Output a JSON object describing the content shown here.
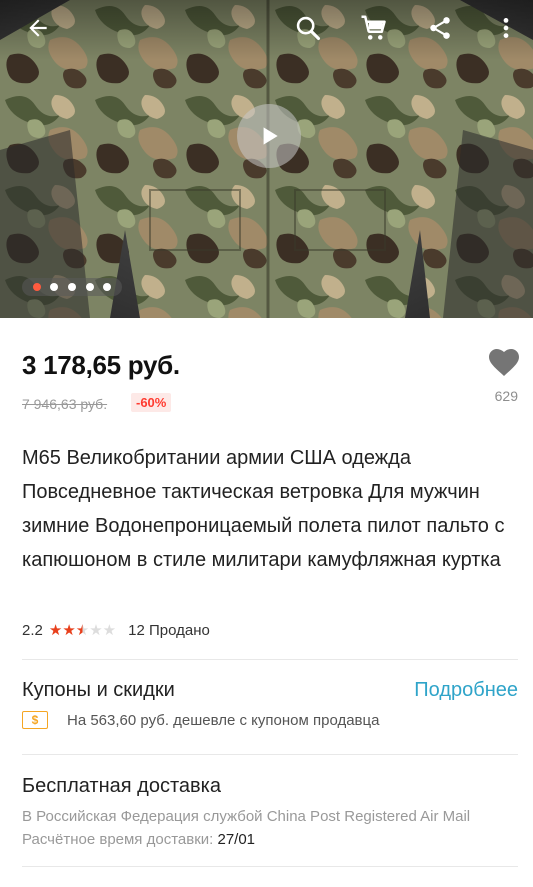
{
  "hero": {
    "image_alt": "camouflage jacket",
    "pager_count": 5,
    "pager_active": 0
  },
  "product": {
    "price": "3 178,65 руб.",
    "old_price": "7 946,63 руб.",
    "discount": "-60%",
    "favorites_count": "629",
    "title": "M65 Великобритании армии США одежда Повседневное тактическая ветровка Для мужчин зимние Водонепроницаемый полета пилот пальто с капюшоном в стиле милитари камуфляжная куртка",
    "rating": "2.2",
    "rating_stars": 2.5,
    "sold": "12 Продано"
  },
  "coupons": {
    "heading": "Купоны и скидки",
    "more_link": "Подробнее",
    "coupon_icon_text": "$",
    "coupon_text": "На 563,60 руб. дешевле с купоном продавца"
  },
  "shipping": {
    "heading": "Бесплатная доставка",
    "line1": "В Российская Федерация службой China Post Registered Air Mail",
    "line2_label": "Расчётное время доставки: ",
    "line2_date": "27/01"
  },
  "colors": {
    "price": "#111111",
    "discount": "#ff3b30",
    "link": "#2fa4c9",
    "star": "#e8401c",
    "pager_active": "#ff5b3f"
  },
  "icons": {
    "back": "back-arrow-icon",
    "search": "search-icon",
    "cart": "cart-icon",
    "share": "share-icon",
    "more": "more-vertical-icon",
    "play": "play-icon",
    "favorite": "heart-icon"
  }
}
